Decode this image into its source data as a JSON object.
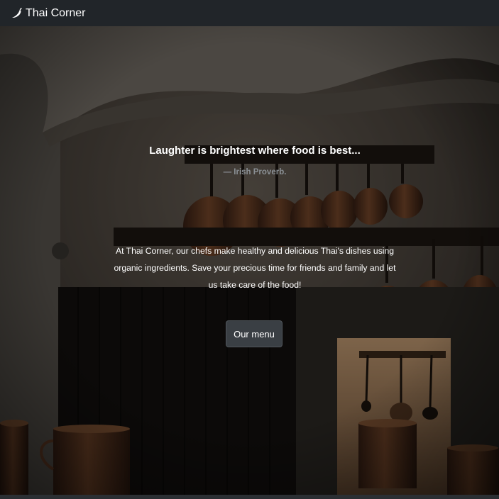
{
  "navbar": {
    "brand_icon": "chili-pepper-icon",
    "brand_text": "Thai Corner"
  },
  "hero": {
    "background": "dark kitchen with copper pots",
    "quote": "Laughter is brightest where food is best...",
    "attribution": "— Irish Proverb.",
    "intro": "At Thai Corner, our chefs make healthy and delicious Thai's dishes using organic ingredients. Save your precious time for friends and family and let us take care of the food!",
    "cta_label": "Our menu"
  },
  "colors": {
    "navbar_bg": "#212529",
    "button_bg": "#3a3f44",
    "attribution_text": "#8a8f94"
  }
}
